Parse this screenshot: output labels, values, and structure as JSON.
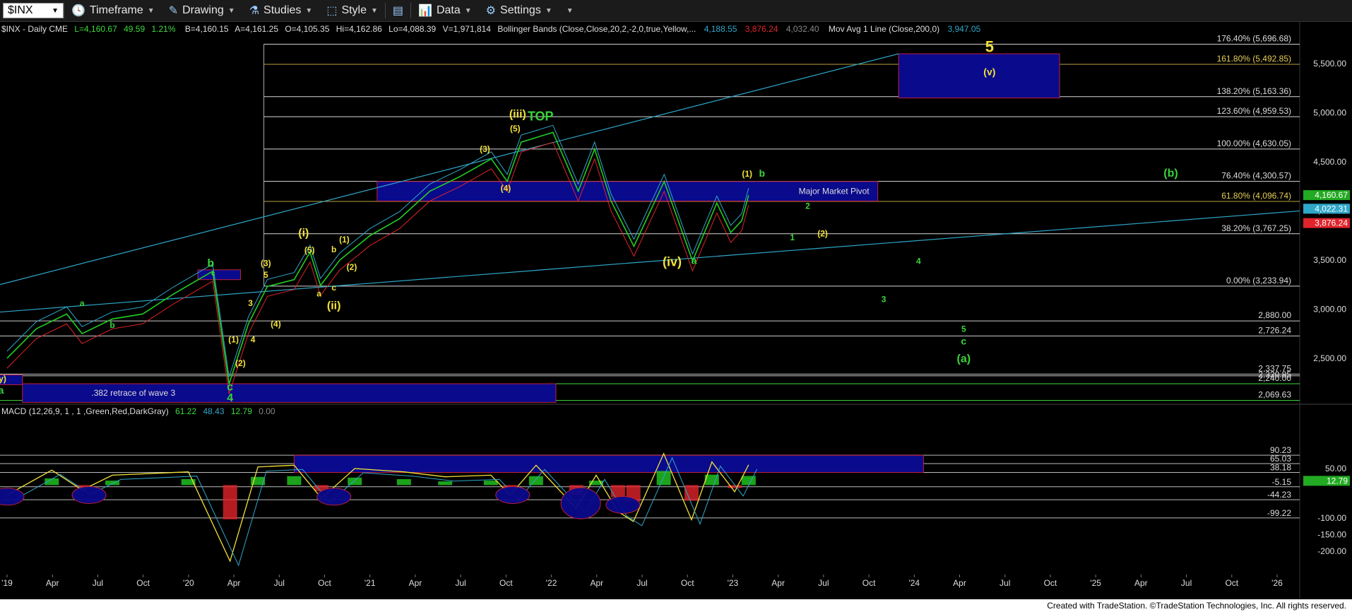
{
  "toolbar": {
    "symbol": "$INX",
    "timeframe": "Timeframe",
    "drawing": "Drawing",
    "studies": "Studies",
    "style": "Style",
    "data": "Data",
    "settings": "Settings"
  },
  "header": {
    "symbol_info": "$INX - Daily CME",
    "last": "L=4,160.67",
    "change": "49.59",
    "change_pct": "1.21%",
    "bid": "B=4,160.15",
    "ask": "A=4,161.25",
    "open": "O=4,105.35",
    "high": "Hi=4,162.86",
    "low": "Lo=4,088.39",
    "volume": "V=1,971,814",
    "bb_label": "Bollinger Bands (Close,Close,20,2,-2,0,true,Yellow,...",
    "bb_upper": "4,188.55",
    "bb_lower": "3,876.24",
    "bb_mid": "4,032.40",
    "ma_label": "Mov Avg 1 Line (Close,200,0)",
    "ma_value": "3,947.05"
  },
  "macd_header": {
    "label": "MACD (12,26,9, 1 , 1 ,Green,Red,DarkGray)",
    "v1": "61.22",
    "v2": "48.43",
    "v3": "12.79",
    "v4": "0.00"
  },
  "footer": "Created with TradeStation. ©TradeStation Technologies, Inc. All rights reserved.",
  "colors": {
    "price": "#22cc22",
    "bb_upper": "#2fa7c9",
    "bb_lower": "#e0242a",
    "ma": "#2fa7c9",
    "fib": "#d8d8d8",
    "box": "#0a0a8c",
    "box_border": "#c0203c",
    "wave_yellow": "#f2e23a",
    "wave_green": "#38d438",
    "macd_pos": "#22cc22",
    "macd_neg": "#e0242a"
  },
  "chart_data": [
    {
      "type": "line",
      "series": [
        {
          "name": "$INX",
          "x": [
            "2019-01-01",
            "2019-03-01",
            "2019-05-01",
            "2019-06-01",
            "2019-08-01",
            "2019-10-01",
            "2019-12-01",
            "2020-02-19",
            "2020-03-23",
            "2020-05-01",
            "2020-06-08",
            "2020-08-01",
            "2020-09-02",
            "2020-09-23",
            "2020-11-01",
            "2021-01-01",
            "2021-03-01",
            "2021-05-01",
            "2021-07-01",
            "2021-09-02",
            "2021-10-04",
            "2021-11-01",
            "2022-01-04",
            "2022-02-24",
            "2022-03-29",
            "2022-05-01",
            "2022-06-16",
            "2022-08-16",
            "2022-10-12",
            "2022-11-30",
            "2022-12-28",
            "2023-01-19",
            "2023-02-02"
          ],
          "values": [
            2500,
            2800,
            2950,
            2750,
            2900,
            2950,
            3150,
            3386,
            2237,
            2850,
            3230,
            3300,
            3580,
            3240,
            3500,
            3750,
            3920,
            4200,
            4350,
            4530,
            4300,
            4700,
            4800,
            4200,
            4630,
            4100,
            3640,
            4300,
            3490,
            4080,
            3780,
            3900,
            4160
          ]
        }
      ],
      "title": "",
      "xlabel": "",
      "ylabel": "",
      "x_ticks": [
        "'19",
        "Apr",
        "Jul",
        "Oct",
        "'20",
        "Apr",
        "Jul",
        "Oct",
        "'21",
        "Apr",
        "Jul",
        "Oct",
        "'22",
        "Apr",
        "Jul",
        "Oct",
        "'23",
        "Apr",
        "Jul",
        "Oct",
        "'24",
        "Apr",
        "Jul",
        "Oct",
        "'25",
        "Apr",
        "Jul",
        "Oct",
        "'26"
      ],
      "y_ticks": [
        "5,500.00",
        "5,000.00",
        "4,500.00",
        "4,000.00",
        "3,500.00",
        "3,000.00",
        "2,500.00"
      ],
      "price_tags": [
        "4,160.67",
        "4,022.31",
        "3,876.24"
      ],
      "fib_levels": [
        {
          "label": "176.40% (5,696.68)",
          "value": 5696.68
        },
        {
          "label": "161.80% (5,492.85)",
          "value": 5492.85
        },
        {
          "label": "138.20% (5,163.36)",
          "value": 5163.36
        },
        {
          "label": "123.60% (4,959.53)",
          "value": 4959.53
        },
        {
          "label": "100.00% (4,630.05)",
          "value": 4630.05
        },
        {
          "label": "76.40% (4,300.57)",
          "value": 4300.57
        },
        {
          "label": "61.80% (4,096.74)",
          "value": 4096.74
        },
        {
          "label": "38.20% (3,767.25)",
          "value": 3767.25
        },
        {
          "label": "0.00% (3,233.94)",
          "value": 3233.94
        }
      ],
      "levels": [
        {
          "label": "2,880.00",
          "value": 2880
        },
        {
          "label": "2,726.24",
          "value": 2726.24
        },
        {
          "label": "2,337.75",
          "value": 2337.75
        },
        {
          "label": "2,320.85",
          "value": 2320.85
        },
        {
          "label": "2,240.00",
          "value": 2240
        },
        {
          "label": "2,069.63",
          "value": 2069.63
        }
      ],
      "boxes": [
        {
          "label": "Major Market Pivot",
          "x0": "2021-01-15",
          "x1": "2023-10-20",
          "y0": 4100,
          "y1": 4300
        },
        {
          "label": "",
          "x0": "2023-12-01",
          "x1": "2024-10-20",
          "y0": 5150,
          "y1": 5600
        },
        {
          "label": ".382 retrace of wave 3",
          "x0": "2019-02-01",
          "x1": "2022-01-10",
          "y0": 2050,
          "y1": 2240
        },
        {
          "label": "",
          "x0": "2020-01-20",
          "x1": "2020-04-15",
          "y0": 3300,
          "y1": 3400
        },
        {
          "label": "",
          "x0": "2018-12-01",
          "x1": "2019-02-01",
          "y0": 2230,
          "y1": 2330
        }
      ],
      "annotations": [
        {
          "text": "5",
          "date": "2024-06-01",
          "value": 5620,
          "color": "yellow",
          "size": 22
        },
        {
          "text": "(v)",
          "date": "2024-06-01",
          "value": 5380,
          "color": "yellow",
          "size": 14
        },
        {
          "text": "(iii)",
          "date": "2021-10-25",
          "value": 4950,
          "color": "yellow",
          "size": 16
        },
        {
          "text": "TOP",
          "date": "2021-12-10",
          "value": 4920,
          "color": "green",
          "size": 18
        },
        {
          "text": "(5)",
          "date": "2021-10-20",
          "value": 4810,
          "color": "yellow",
          "size": 12
        },
        {
          "text": "(3)",
          "date": "2021-08-20",
          "value": 4600,
          "color": "yellow",
          "size": 12
        },
        {
          "text": "(4)",
          "date": "2021-10-01",
          "value": 4200,
          "color": "yellow",
          "size": 12
        },
        {
          "text": "(1)",
          "date": "2023-01-30",
          "value": 4350,
          "color": "yellow",
          "size": 12
        },
        {
          "text": "b",
          "date": "2023-03-01",
          "value": 4350,
          "color": "green",
          "size": 14
        },
        {
          "text": "(b)",
          "date": "2025-06-01",
          "value": 4350,
          "color": "green",
          "size": 16
        },
        {
          "text": "2",
          "date": "2023-06-01",
          "value": 4020,
          "color": "green",
          "size": 12
        },
        {
          "text": "1",
          "date": "2023-05-01",
          "value": 3700,
          "color": "green",
          "size": 12
        },
        {
          "text": "(2)",
          "date": "2023-07-01",
          "value": 3740,
          "color": "yellow",
          "size": 12
        },
        {
          "text": "4",
          "date": "2024-01-10",
          "value": 3460,
          "color": "green",
          "size": 12
        },
        {
          "text": "3",
          "date": "2023-11-01",
          "value": 3070,
          "color": "green",
          "size": 12
        },
        {
          "text": "5",
          "date": "2024-04-10",
          "value": 2770,
          "color": "green",
          "size": 12
        },
        {
          "text": "c",
          "date": "2024-04-10",
          "value": 2640,
          "color": "green",
          "size": 14
        },
        {
          "text": "(a)",
          "date": "2024-04-10",
          "value": 2460,
          "color": "green",
          "size": 16
        },
        {
          "text": "(iv)",
          "date": "2022-09-01",
          "value": 3440,
          "color": "yellow",
          "size": 18
        },
        {
          "text": "a",
          "date": "2022-10-15",
          "value": 3460,
          "color": "green",
          "size": 14
        },
        {
          "text": "(i)",
          "date": "2020-08-20",
          "value": 3740,
          "color": "yellow",
          "size": 16
        },
        {
          "text": "(5)",
          "date": "2020-09-01",
          "value": 3570,
          "color": "yellow",
          "size": 12
        },
        {
          "text": "b",
          "date": "2020-10-20",
          "value": 3580,
          "color": "yellow",
          "size": 12
        },
        {
          "text": "(1)",
          "date": "2020-11-10",
          "value": 3680,
          "color": "yellow",
          "size": 12
        },
        {
          "text": "(2)",
          "date": "2020-11-25",
          "value": 3400,
          "color": "yellow",
          "size": 12
        },
        {
          "text": "a",
          "date": "2020-09-20",
          "value": 3130,
          "color": "yellow",
          "size": 12
        },
        {
          "text": "c",
          "date": "2020-10-20",
          "value": 3190,
          "color": "yellow",
          "size": 12
        },
        {
          "text": "(ii)",
          "date": "2020-10-20",
          "value": 3000,
          "color": "yellow",
          "size": 16
        },
        {
          "text": "(3)",
          "date": "2020-06-05",
          "value": 3440,
          "color": "yellow",
          "size": 12
        },
        {
          "text": "5",
          "date": "2020-06-05",
          "value": 3320,
          "color": "yellow",
          "size": 12
        },
        {
          "text": "3",
          "date": "2020-05-05",
          "value": 3030,
          "color": "yellow",
          "size": 12
        },
        {
          "text": "(4)",
          "date": "2020-06-25",
          "value": 2820,
          "color": "yellow",
          "size": 12
        },
        {
          "text": "4",
          "date": "2020-05-10",
          "value": 2660,
          "color": "yellow",
          "size": 12
        },
        {
          "text": "(1)",
          "date": "2020-04-01",
          "value": 2660,
          "color": "yellow",
          "size": 12
        },
        {
          "text": "(2)",
          "date": "2020-04-15",
          "value": 2420,
          "color": "yellow",
          "size": 12
        },
        {
          "text": "b",
          "date": "2020-02-15",
          "value": 3430,
          "color": "green",
          "size": 16
        },
        {
          "text": "c",
          "date": "2020-02-20",
          "value": 3340,
          "color": "green",
          "size": 10
        },
        {
          "text": "c",
          "date": "2020-03-25",
          "value": 2170,
          "color": "green",
          "size": 16
        },
        {
          "text": "4",
          "date": "2020-03-25",
          "value": 2060,
          "color": "green",
          "size": 16
        },
        {
          "text": "a",
          "date": "2019-06-01",
          "value": 3030,
          "color": "green",
          "size": 12
        },
        {
          "text": "b",
          "date": "2019-08-01",
          "value": 2810,
          "color": "green",
          "size": 12
        },
        {
          "text": "a",
          "date": "2018-12-20",
          "value": 2140,
          "color": "green",
          "size": 14
        },
        {
          "text": "(y)",
          "date": "2018-12-20",
          "value": 2260,
          "color": "yellow",
          "size": 12
        }
      ]
    },
    {
      "type": "line",
      "title": "",
      "series": [
        {
          "name": "MACD",
          "x": [
            "2019-01-01",
            "2019-04-01",
            "2019-06-01",
            "2019-08-01",
            "2020-01-01",
            "2020-03-25",
            "2020-05-20",
            "2020-08-01",
            "2020-09-25",
            "2020-12-01",
            "2021-03-10",
            "2021-06-01",
            "2021-09-01",
            "2021-10-10",
            "2021-12-01",
            "2022-02-20",
            "2022-04-01",
            "2022-05-15",
            "2022-06-15",
            "2022-08-15",
            "2022-10-10",
            "2022-11-20",
            "2023-01-05",
            "2023-02-02"
          ],
          "values": [
            -30,
            45,
            -15,
            30,
            40,
            -230,
            55,
            60,
            -40,
            50,
            40,
            25,
            30,
            -30,
            60,
            -70,
            30,
            -80,
            -110,
            95,
            -105,
            70,
            -20,
            61.22
          ]
        }
      ],
      "y_ticks": [
        "50.00",
        "-100.00",
        "-150.00",
        "-200.00"
      ],
      "levels": [
        {
          "label": "65.03",
          "value": 65.03
        },
        {
          "label": "38.18",
          "value": 38.18
        },
        {
          "label": "-5.15",
          "value": -5.15
        },
        {
          "label": "-44.23",
          "value": -44.23
        },
        {
          "label": "-99.22",
          "value": -99.22
        },
        {
          "label": "90.23",
          "value": 90.23
        }
      ],
      "last_tag": "12.79"
    }
  ]
}
